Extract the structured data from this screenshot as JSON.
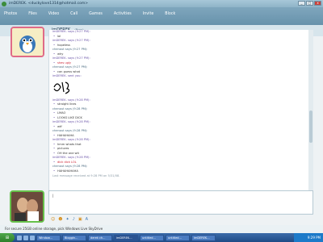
{
  "window": {
    "title": "imDEREK. <duckylove1314@hotmail.com>",
    "min": "_",
    "max": "□",
    "close": "x"
  },
  "menu": [
    "Photos",
    "Files",
    "Video",
    "Call",
    "Games",
    "Activities",
    "Invite",
    "Block"
  ],
  "contact": {
    "name": "imDEREK.",
    "status": "(Busy)"
  },
  "conversation": [
    {
      "type": "header",
      "who": "a",
      "text": "imDEREK. says (9:27 PM):"
    },
    {
      "type": "msg",
      "text": "lol"
    },
    {
      "type": "header",
      "who": "a",
      "text": "imDEREK. says (9:27 PM):"
    },
    {
      "type": "msg",
      "text": "hopeless"
    },
    {
      "type": "header",
      "who": "b",
      "text": "chenout says (9:27 PM):"
    },
    {
      "type": "msg",
      "text": "why"
    },
    {
      "type": "header",
      "who": "a",
      "text": "imDEREK. says (9:27 PM):"
    },
    {
      "type": "msg",
      "text": "shes ugly",
      "red": true
    },
    {
      "type": "header",
      "who": "b",
      "text": "chenout says (9:27 PM):"
    },
    {
      "type": "msg",
      "text": "can guess what"
    },
    {
      "type": "header",
      "who": "a",
      "text": "imDEREK. sent you:"
    },
    {
      "type": "doodle"
    },
    {
      "type": "header",
      "who": "a",
      "text": "imDEREK. says (9:28 PM):"
    },
    {
      "type": "msg",
      "text": "straight lines"
    },
    {
      "type": "header",
      "who": "b",
      "text": "chenout says (9:28 PM):"
    },
    {
      "type": "msg",
      "text": "LMAO"
    },
    {
      "type": "msg",
      "text": "LOOKS LIKE DICK"
    },
    {
      "type": "header",
      "who": "a",
      "text": "imDEREK. says (9:28 PM):"
    },
    {
      "type": "msg",
      "text": "wtf"
    },
    {
      "type": "header",
      "who": "b",
      "text": "chenout says (9:28 PM):"
    },
    {
      "type": "msg",
      "text": "HAHAHAHA"
    },
    {
      "type": "header",
      "who": "a",
      "text": "imDEREK. says (9:28 PM):"
    },
    {
      "type": "msg",
      "text": "hmm whats that"
    },
    {
      "type": "msg",
      "text": "pictures"
    },
    {
      "type": "msg",
      "text": "OH the one wit"
    },
    {
      "type": "header",
      "who": "a",
      "text": "imDEREK. says (9:28 PM):"
    },
    {
      "type": "msg",
      "text": "dick dick LOL",
      "red": true
    },
    {
      "type": "header",
      "who": "b",
      "text": "chenout says (9:28 PM):"
    },
    {
      "type": "msg",
      "text": "HAHAHAHAHA"
    }
  ],
  "last_message": "Last message received at 9:28 PM on 5/31/08.",
  "input": {
    "value": "|"
  },
  "banner": "For secure 25GB online storage, pick Windows Live SkyDrive",
  "taskbar": {
    "tasks": [
      "Window...",
      "Bloggin...",
      "derek ch...",
      "imDEREK...",
      "untitled...",
      "untitled...",
      "imDEREK..."
    ],
    "clock": "9:29 PM"
  },
  "colors": {
    "accent": "#6792ab",
    "says_a": "#6b54a8",
    "says_b": "#4a6b80"
  }
}
